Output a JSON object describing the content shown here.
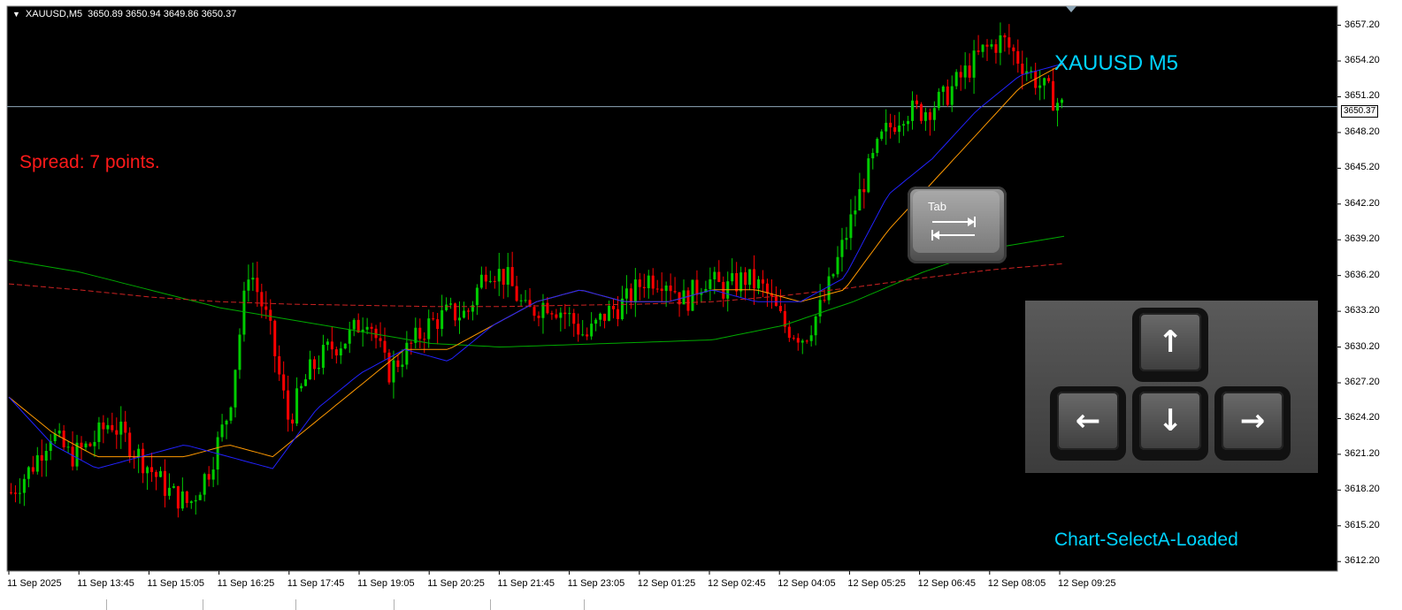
{
  "header": {
    "symbol": "XAUUSD,M5",
    "ohlc": "3650.89 3650.94 3649.86 3650.37"
  },
  "overlay": {
    "spread_text": "Spread: 7 points.",
    "symbol_label": "XAUUSD M5",
    "status_label": "Chart-SelectA-Loaded",
    "tab_key_label": "Tab",
    "arrow_keys": {
      "up": "↑",
      "left": "←",
      "down": "↓",
      "right": "→"
    }
  },
  "colors": {
    "background": "#000000",
    "bull_candle": "#00cc00",
    "bear_candle": "#ff0000",
    "ma_fast": "#2222ff",
    "ma_mid": "#ff9900",
    "ma_slow": "#00aa00",
    "ma_dashed": "#cc2222",
    "bid_line": "#8fa7b8",
    "label_cyan": "#00d4ff",
    "spread_red": "#ff1a1a"
  },
  "chart_data": {
    "type": "candlestick",
    "current_price": 3650.37,
    "price_badge": "3650.37",
    "ylim": [
      3611.4,
      3658.8
    ],
    "y_ticks": [
      "3657.20",
      "3654.20",
      "3651.20",
      "3648.20",
      "3645.20",
      "3642.20",
      "3639.20",
      "3636.20",
      "3633.20",
      "3630.20",
      "3627.20",
      "3624.20",
      "3621.20",
      "3618.20",
      "3615.20",
      "3612.20"
    ],
    "x_ticks": [
      "11 Sep 2025",
      "11 Sep 13:45",
      "11 Sep 15:05",
      "11 Sep 16:25",
      "11 Sep 17:45",
      "11 Sep 19:05",
      "11 Sep 20:25",
      "11 Sep 21:45",
      "11 Sep 23:05",
      "12 Sep 01:25",
      "12 Sep 02:45",
      "12 Sep 04:05",
      "12 Sep 05:25",
      "12 Sep 06:45",
      "12 Sep 08:05",
      "12 Sep 09:25"
    ],
    "price_path": [
      3618,
      3620,
      3623,
      3621,
      3622,
      3624,
      3622,
      3620,
      3618,
      3617,
      3620,
      3625,
      3637,
      3632,
      3624,
      3628,
      3630,
      3631,
      3633,
      3628,
      3630,
      3632,
      3633,
      3633,
      3637,
      3636,
      3633,
      3634,
      3633,
      3631,
      3633,
      3634,
      3636,
      3636,
      3634,
      3636,
      3635,
      3636,
      3635,
      3632,
      3631,
      3634,
      3639,
      3644,
      3648,
      3650,
      3650,
      3651,
      3653,
      3655,
      3656,
      3654,
      3652,
      3650.4
    ],
    "ma_fast": [
      3626,
      3622,
      3620,
      3621,
      3622,
      3621,
      3620,
      3625,
      3628,
      3630,
      3629,
      3632,
      3634,
      3635,
      3634,
      3634,
      3635,
      3634,
      3634,
      3636,
      3643,
      3646,
      3650,
      3653,
      3654
    ],
    "ma_mid": [
      3626,
      3623,
      3621,
      3621,
      3621,
      3622,
      3621,
      3624,
      3627,
      3630,
      3630,
      3632,
      3634,
      3635,
      3634,
      3634,
      3635,
      3635,
      3634,
      3635,
      3640,
      3644,
      3648,
      3652,
      3654
    ],
    "ma_slow": [
      3637.5,
      3636.5,
      3635,
      3633.5,
      3632.5,
      3631.5,
      3630.5,
      3630.2,
      3630.4,
      3630.6,
      3630.8,
      3632,
      3634,
      3636.5,
      3638.5,
      3639.5
    ],
    "ma_dashed": [
      3635.5,
      3635,
      3634.4,
      3634,
      3633.8,
      3633.7,
      3633.6,
      3633.6,
      3633.7,
      3633.8,
      3634,
      3634.5,
      3635.2,
      3636,
      3636.7,
      3637.2
    ]
  }
}
